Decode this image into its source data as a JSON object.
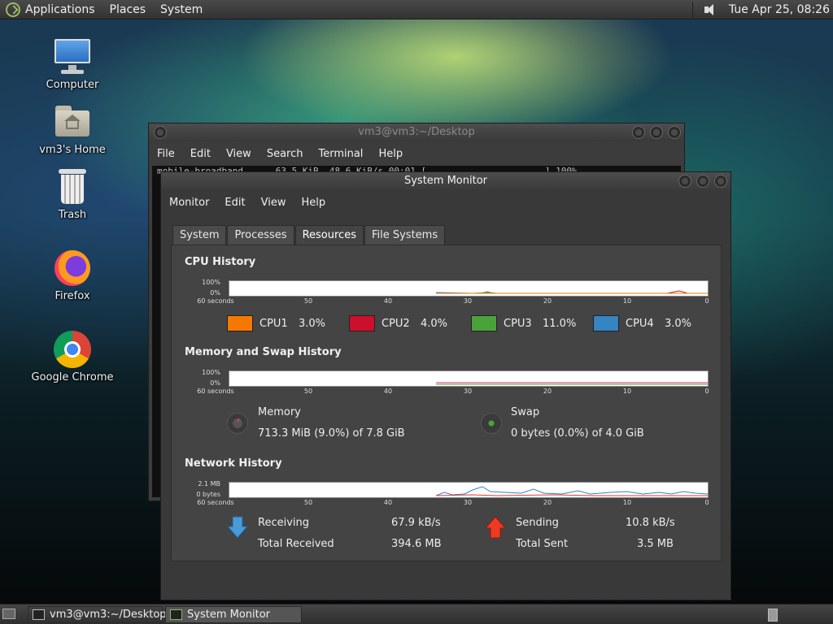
{
  "top_panel": {
    "menus": [
      "Applications",
      "Places",
      "System"
    ],
    "clock": "Tue Apr 25, 08:26"
  },
  "desktop": {
    "icons": [
      {
        "label": "Computer",
        "icon": "computer-icon"
      },
      {
        "label": "vm3's Home",
        "icon": "home-folder-icon"
      },
      {
        "label": "Trash",
        "icon": "trash-icon"
      },
      {
        "label": "Firefox",
        "icon": "firefox-icon"
      },
      {
        "label": "Google Chrome",
        "icon": "chrome-icon"
      }
    ]
  },
  "terminal": {
    "title": "vm3@vm3:~/Desktop",
    "menus": [
      "File",
      "Edit",
      "View",
      "Search",
      "Terminal",
      "Help"
    ],
    "first_line": "mobile-broadband      63.5 KiB  48.6 KiB/s 00:01 [                      ] 100%"
  },
  "sysmon": {
    "title": "System Monitor",
    "menus": [
      "Monitor",
      "Edit",
      "View",
      "Help"
    ],
    "tabs": [
      "System",
      "Processes",
      "Resources",
      "File Systems"
    ],
    "active_tab": "Resources",
    "x_ticks": [
      "60 seconds",
      "50",
      "40",
      "30",
      "20",
      "10",
      "0"
    ],
    "cpu": {
      "title": "CPU History",
      "y_top": "100%",
      "y_bottom": "0%",
      "cores": [
        {
          "name": "CPU1",
          "value": "3.0%",
          "color": "#f57900"
        },
        {
          "name": "CPU2",
          "value": "4.0%",
          "color": "#cc0f2c"
        },
        {
          "name": "CPU3",
          "value": "11.0%",
          "color": "#4aa33a"
        },
        {
          "name": "CPU4",
          "value": "3.0%",
          "color": "#3584c4"
        }
      ]
    },
    "memory": {
      "title": "Memory and Swap History",
      "y_top": "100%",
      "y_bottom": "0%",
      "memory_label": "Memory",
      "memory_value": "713.3 MiB (9.0%) of 7.8 GiB",
      "memory_color": "#e0306a",
      "swap_label": "Swap",
      "swap_value": "0 bytes (0.0%) of 4.0 GiB",
      "swap_color": "#4aa33a"
    },
    "network": {
      "title": "Network History",
      "y_top": "2.1 MB",
      "y_bottom": "0 bytes",
      "receiving_label": "Receiving",
      "receiving_value": "67.9 kB/s",
      "total_received_label": "Total Received",
      "total_received_value": "394.6 MB",
      "sending_label": "Sending",
      "sending_value": "10.8 kB/s",
      "total_sent_label": "Total Sent",
      "total_sent_value": "3.5 MB",
      "receive_color": "#3584c4",
      "send_color": "#e53a2a"
    }
  },
  "taskbar": {
    "tasks": [
      {
        "label": "vm3@vm3:~/Desktop",
        "active": false
      },
      {
        "label": "System Monitor",
        "active": true
      }
    ]
  }
}
